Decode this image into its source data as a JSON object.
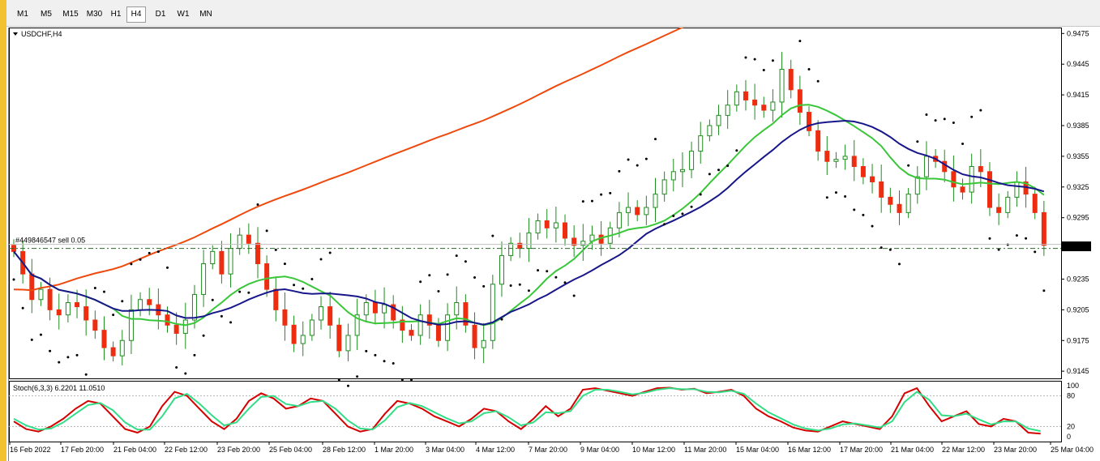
{
  "timeframes": [
    "M1",
    "M5",
    "M15",
    "M30",
    "H1",
    "H4",
    "D1",
    "W1",
    "MN"
  ],
  "active_timeframe": "H4",
  "chart": {
    "symbol_title": "USDCHF,H4",
    "trade_label": "#449846547 sell 0.05",
    "current_price": "0.9267",
    "indicator_title": "Stoch(6,3,3) 6.2201 11.0510",
    "colors": {
      "bull": "#ffffff",
      "bear": "#ee2d10",
      "candle_outline": "#1e8c1e",
      "ma_green": "#39c739",
      "ma_blue": "#17178a",
      "ma_orange": "#ee4a0e",
      "sar": "#000000",
      "stoch_main": "#d50000",
      "stoch_signal": "#33dd88",
      "trade_line": "#2a6a2a"
    }
  },
  "chart_data": [
    {
      "type": "candlestick",
      "title": "USDCHF,H4",
      "price_ticks": [
        "0.9475",
        "0.9445",
        "0.9415",
        "0.9385",
        "0.9355",
        "0.9325",
        "0.9295",
        "0.9265",
        "0.9235",
        "0.9205",
        "0.9175",
        "0.9145"
      ],
      "ylim": [
        0.9138,
        0.948
      ],
      "time_ticks": [
        "16 Feb 2022",
        "17 Feb 20:00",
        "21 Feb 04:00",
        "22 Feb 12:00",
        "23 Feb 20:00",
        "25 Feb 04:00",
        "28 Feb 12:00",
        "1 Mar 20:00",
        "3 Mar 04:00",
        "4 Mar 12:00",
        "7 Mar 20:00",
        "9 Mar 04:00",
        "10 Mar 12:00",
        "11 Mar 20:00",
        "15 Mar 04:00",
        "16 Mar 12:00",
        "17 Mar 20:00",
        "21 Mar 04:00",
        "22 Mar 12:00",
        "23 Mar 20:00",
        "25 Mar 04:00"
      ],
      "close_path": [
        0.9262,
        0.924,
        0.9215,
        0.9225,
        0.9205,
        0.92,
        0.9212,
        0.9208,
        0.9195,
        0.9185,
        0.9168,
        0.916,
        0.9175,
        0.9205,
        0.9215,
        0.921,
        0.92,
        0.919,
        0.9182,
        0.9195,
        0.922,
        0.925,
        0.9262,
        0.924,
        0.9265,
        0.9278,
        0.927,
        0.925,
        0.9225,
        0.9205,
        0.919,
        0.9172,
        0.918,
        0.9195,
        0.9208,
        0.919,
        0.9165,
        0.918,
        0.92,
        0.9212,
        0.9202,
        0.921,
        0.9195,
        0.9185,
        0.918,
        0.92,
        0.919,
        0.9175,
        0.92,
        0.9212,
        0.919,
        0.9168,
        0.9175,
        0.923,
        0.9258,
        0.927,
        0.9265,
        0.928,
        0.9292,
        0.9285,
        0.929,
        0.9275,
        0.9268,
        0.9272,
        0.9278,
        0.927,
        0.9285,
        0.93,
        0.9305,
        0.9298,
        0.9305,
        0.9318,
        0.9332,
        0.934,
        0.9342,
        0.936,
        0.9375,
        0.9385,
        0.9395,
        0.9405,
        0.9418,
        0.941,
        0.9405,
        0.94,
        0.9408,
        0.944,
        0.942,
        0.9398,
        0.938,
        0.936,
        0.935,
        0.9352,
        0.9355,
        0.9345,
        0.9335,
        0.933,
        0.9315,
        0.9308,
        0.93,
        0.9318,
        0.9335,
        0.9355,
        0.935,
        0.934,
        0.9325,
        0.932,
        0.9345,
        0.934,
        0.9305,
        0.93,
        0.9315,
        0.933,
        0.9318,
        0.93,
        0.9268
      ],
      "indicators": [
        "Moving Average (green)",
        "Moving Average (blue)",
        "Moving Average (orange)",
        "Parabolic SAR",
        "Stoch(6,3,3)"
      ]
    },
    {
      "type": "line",
      "title": "Stoch(6,3,3) 6.2201 11.0510",
      "levels": [
        "100",
        "80",
        "20",
        "0"
      ],
      "ylim": [
        0,
        100
      ],
      "series": [
        {
          "name": "Stoch(6,3,3)",
          "values": [
            30,
            15,
            10,
            20,
            35,
            55,
            70,
            65,
            40,
            15,
            8,
            20,
            60,
            88,
            80,
            55,
            30,
            15,
            35,
            70,
            85,
            75,
            55,
            60,
            75,
            70,
            45,
            20,
            10,
            15,
            45,
            70,
            65,
            55,
            40,
            30,
            20,
            35,
            55,
            50,
            30,
            15,
            35,
            60,
            40,
            55,
            92,
            95,
            90,
            85,
            80,
            88,
            95,
            96,
            92,
            94,
            85,
            88,
            92,
            80,
            55,
            40,
            30,
            18,
            12,
            10,
            20,
            30,
            25,
            20,
            15,
            40,
            85,
            95,
            60,
            30,
            40,
            50,
            25,
            20,
            35,
            30,
            8,
            6
          ]
        },
        {
          "name": "Signal",
          "values": [
            35,
            22,
            14,
            16,
            28,
            45,
            62,
            66,
            52,
            28,
            14,
            14,
            40,
            75,
            84,
            65,
            42,
            22,
            28,
            55,
            78,
            80,
            64,
            60,
            68,
            70,
            55,
            32,
            16,
            14,
            32,
            58,
            66,
            60,
            48,
            36,
            26,
            30,
            46,
            50,
            38,
            22,
            28,
            48,
            46,
            50,
            80,
            92,
            92,
            88,
            83,
            86,
            92,
            95,
            93,
            93,
            88,
            87,
            90,
            84,
            65,
            48,
            36,
            24,
            16,
            12,
            16,
            24,
            26,
            22,
            18,
            30,
            68,
            88,
            72,
            42,
            40,
            45,
            34,
            24,
            30,
            30,
            16,
            11
          ]
        }
      ]
    }
  ]
}
